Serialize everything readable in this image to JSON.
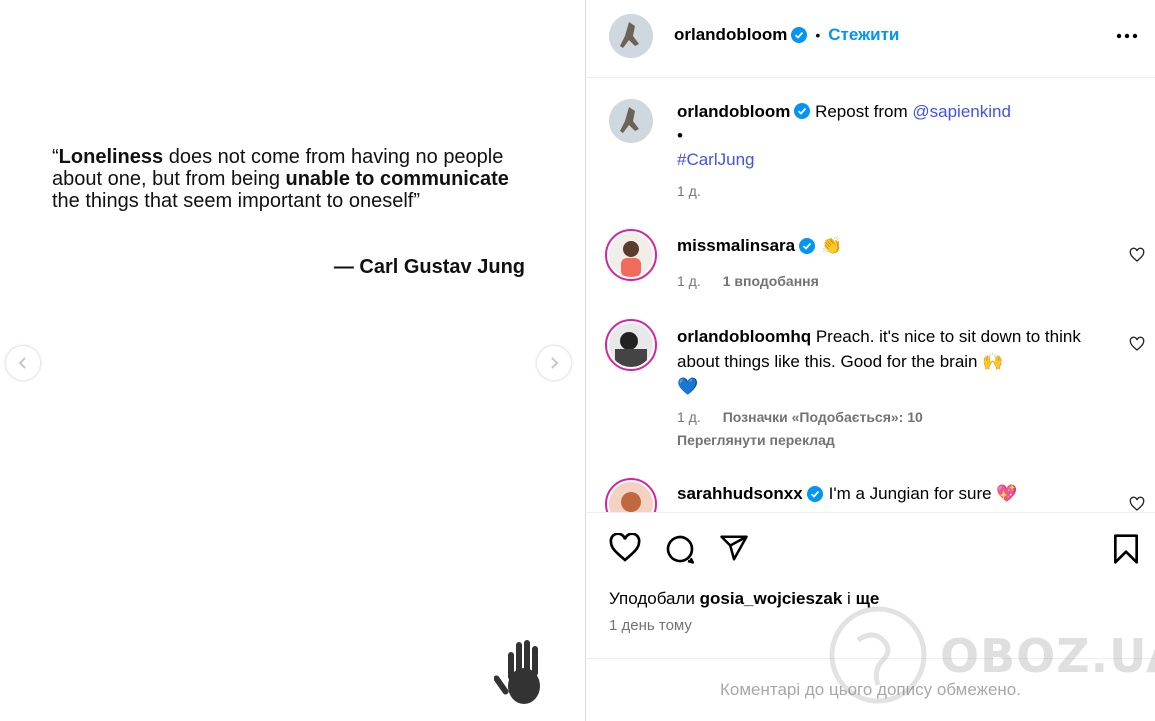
{
  "post": {
    "quote_part1": "“",
    "quote_bold1": "Loneliness",
    "quote_part2": " does not come from having no people about one, but from being ",
    "quote_bold2": "unable to communicate",
    "quote_part3": " the things that seem important to oneself”",
    "author": "— Carl Gustav Jung"
  },
  "header": {
    "username": "orlandobloom",
    "dot": "•",
    "follow_label": "Стежити",
    "more_icon": "more-options-icon"
  },
  "caption": {
    "username": "orlandobloom",
    "text": "Repost from ",
    "mention": "@sapienkind",
    "bullet": "•",
    "hashtag": "#CarlJung",
    "time": "1 д."
  },
  "comments": [
    {
      "username": "missmalinsara",
      "text": "👏",
      "time": "1 д.",
      "likes": "1 вподобання"
    },
    {
      "username": "orlandobloomhq",
      "text": "Preach. it's nice to sit down to think about things like this. Good for the brain 🙌",
      "text_line2": "💙",
      "time": "1 д.",
      "likes": "Позначки «Подобається»: 10",
      "translate": "Переглянути переклад"
    },
    {
      "username": "sarahhudsonxx",
      "text": "I'm a Jungian for sure 💖"
    }
  ],
  "likes_line": {
    "prefix": "Уподобали ",
    "user": "gosia_wojcieszak",
    "mid": " і ",
    "more": "ще"
  },
  "posted": "1 день тому",
  "footer_text": "Коментарі до цього допису обмежено.",
  "watermark": "OBOZ.UA",
  "colors": {
    "accent_blue": "#0095f6",
    "link_blue": "#4150f7",
    "verified": "#0095f6",
    "muted": "#737373",
    "story_ring": "#d6249f"
  }
}
